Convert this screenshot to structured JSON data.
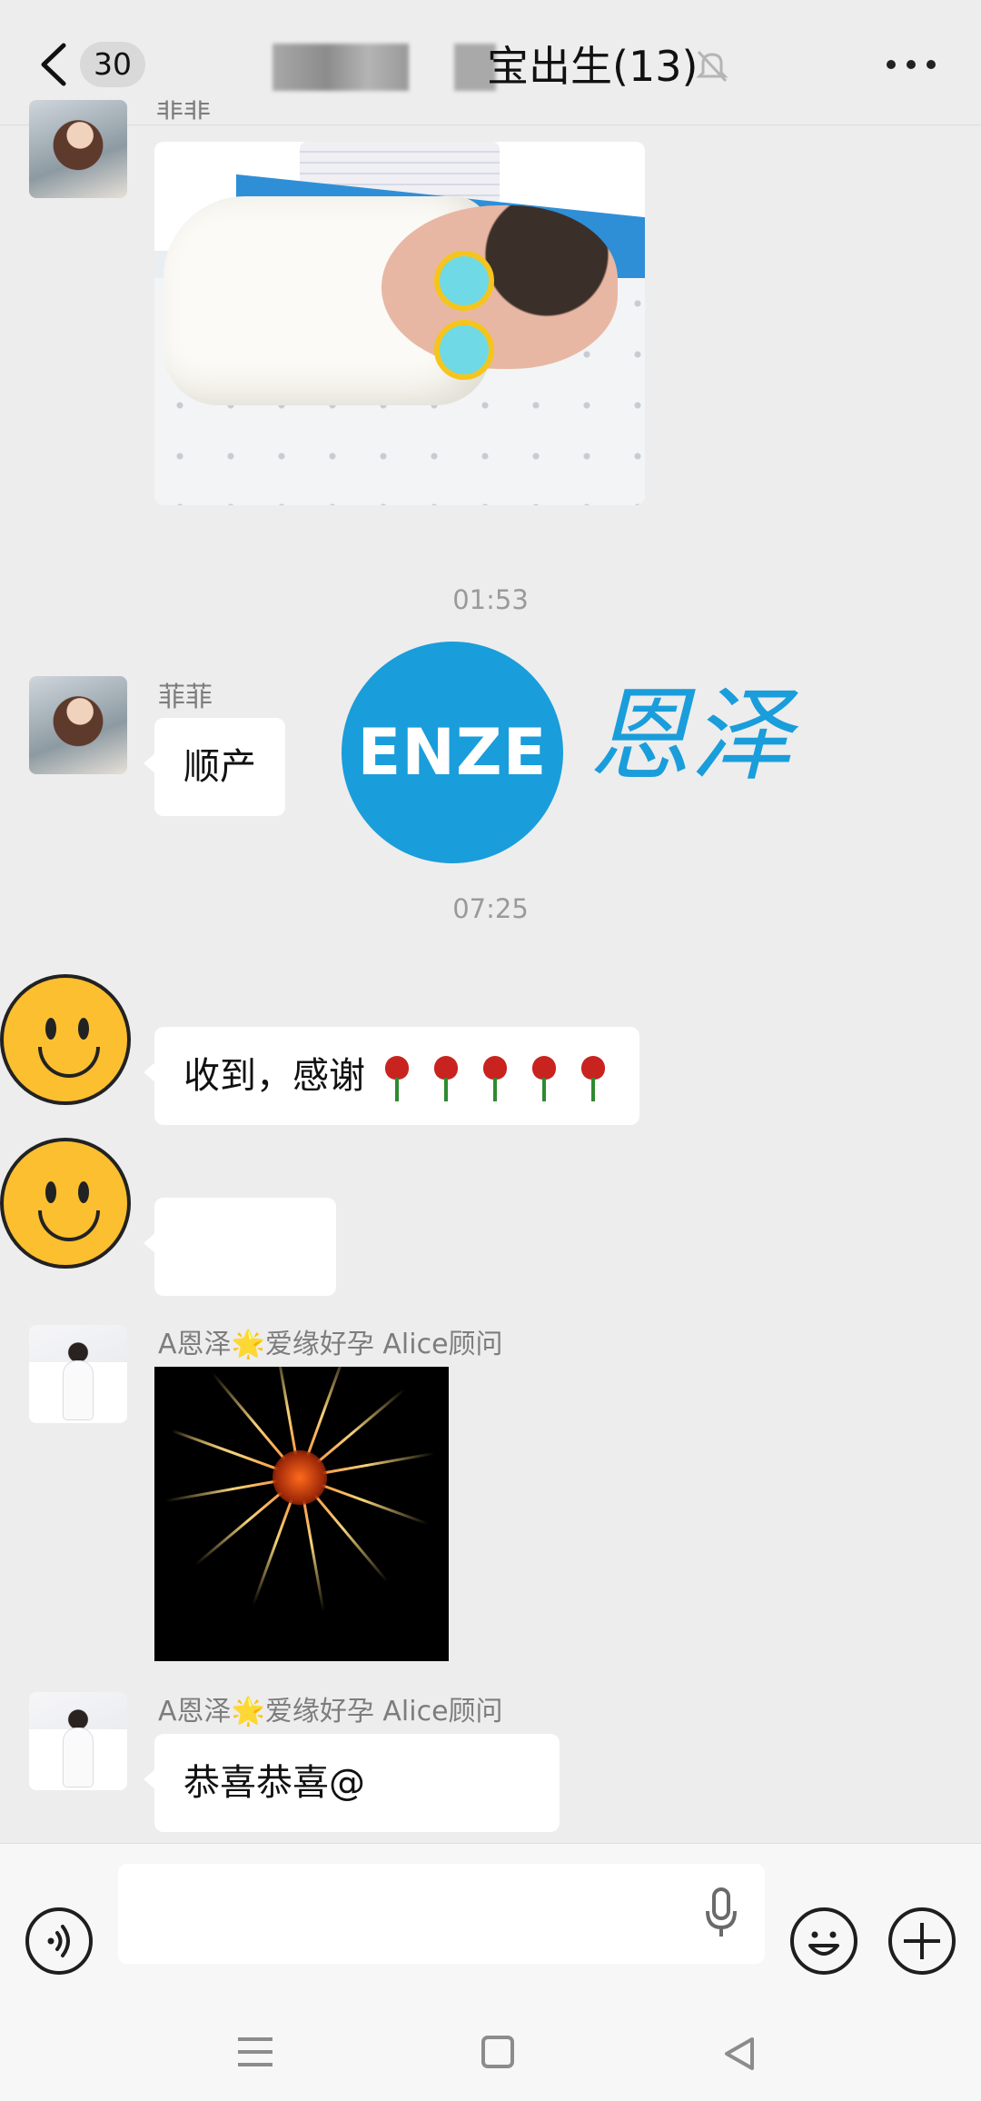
{
  "header": {
    "back_count": "30",
    "title": "宝出生(13)"
  },
  "messages": [
    {
      "sender": "菲菲",
      "type": "image",
      "description": "newborn baby photo"
    },
    {
      "time": "01:53"
    },
    {
      "sender": "菲菲",
      "type": "text",
      "text": "顺产"
    },
    {
      "time": "07:25"
    },
    {
      "type": "text",
      "text": "收到，感谢",
      "emoji_count": 5
    },
    {
      "type": "text",
      "text": ""
    },
    {
      "sender": "A恩泽🌟爱缘好孕 Alice顾问",
      "type": "image",
      "description": "fireworks"
    },
    {
      "sender": "A恩泽🌟爱缘好孕 Alice顾问",
      "type": "text",
      "text": "恭喜恭喜@"
    }
  ],
  "watermark": {
    "logo_text": "ENZE",
    "brand_text": "恩泽",
    "color": "#1a9ddb"
  },
  "input_bar": {
    "icons": [
      "voice-icon",
      "microphone-icon",
      "emoji-icon",
      "plus-icon"
    ]
  },
  "navigation_bar": {
    "icons": [
      "menu-icon",
      "home-icon",
      "back-triangle-icon"
    ]
  }
}
